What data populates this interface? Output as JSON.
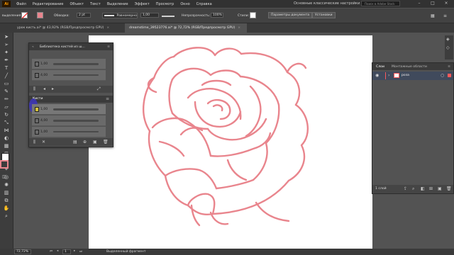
{
  "menu": {
    "items": [
      "Файл",
      "Редактирование",
      "Объект",
      "Текст",
      "Выделение",
      "Эффект",
      "Просмотр",
      "Окно",
      "Справка"
    ],
    "workspace": "Основные классические настройки",
    "stock_search_placeholder": "Поиск в Adobe Stock"
  },
  "control_bar": {
    "selection_label": "выделения",
    "stroke_label": "Обводка:",
    "stroke_weight": "2 pt",
    "profile_label": "Равномерно",
    "brush_size": "1,00",
    "opacity_label": "Непрозрачность:",
    "opacity_value": "100%",
    "styles_label": "Стили:",
    "doc_params_button": "Параметры документа",
    "settings_button": "Установки"
  },
  "tabs": [
    {
      "label": "урок кисть.ai* @ 43,92% (RGB/Предпросмотр GPU)",
      "close": "×"
    },
    {
      "label": "dreamstime_39523776.ai* @ 72,72% (RGB/Предпросмотр GPU)",
      "close": "×"
    }
  ],
  "brush_panel": {
    "title": "Библиотека кистей из ш...",
    "top_rows": [
      "1,00",
      "4,00"
    ],
    "sub_title": "Кисти",
    "bottom_rows": [
      "1,00",
      "4,00",
      "1,00"
    ]
  },
  "layers_panel": {
    "tab_layers": "Слои",
    "tab_artboards": "Монтажные области",
    "layer_name": "роза",
    "footer_count": "1 слой"
  },
  "status_bar": {
    "zoom": "72,72%",
    "page": "1",
    "tool_name": "Выделенный фрагмент"
  },
  "colors": {
    "rose_stroke": "#e9858d",
    "accent": "#ff9a00",
    "cursor_highlight": "#3e36b7",
    "layer_color": "#ff5a5a"
  }
}
